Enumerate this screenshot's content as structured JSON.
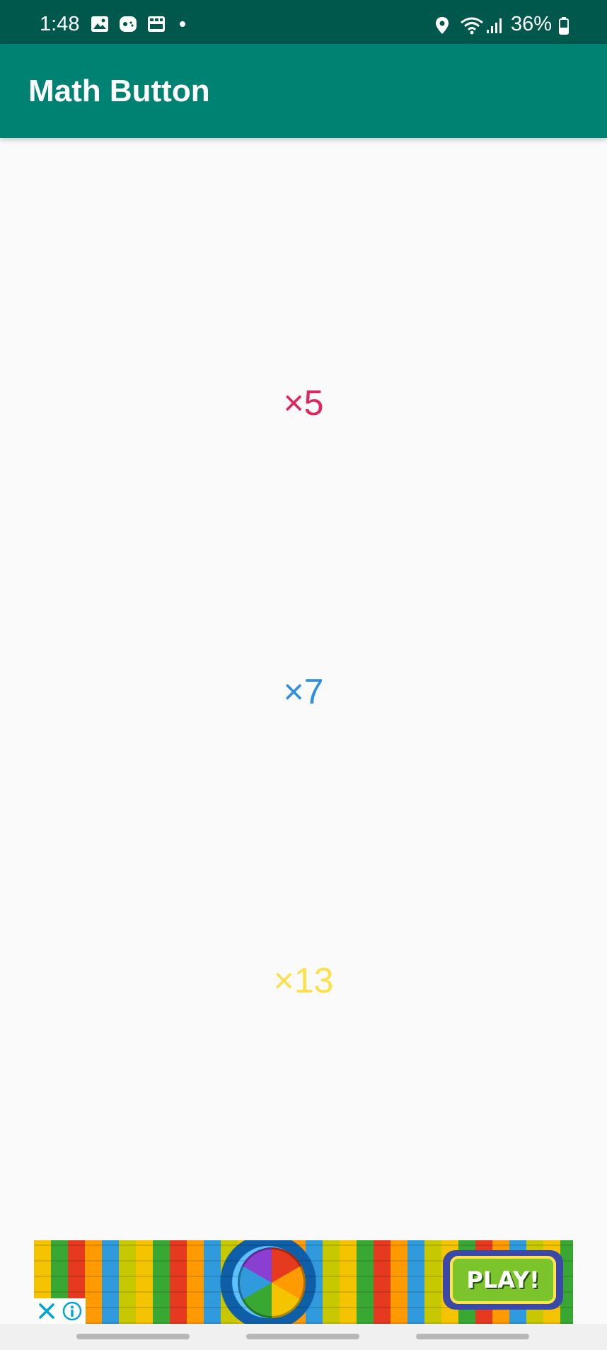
{
  "status_bar": {
    "time": "1:48",
    "battery": "36%",
    "left_icons": [
      "gallery-icon",
      "game-controller-icon",
      "calendar-app-icon",
      "notification-dot-icon"
    ],
    "right_icons": [
      "location-icon",
      "wifi-icon",
      "signal-icon",
      "battery-icon"
    ]
  },
  "app_bar": {
    "title": "Math Button",
    "color": "#008272"
  },
  "buttons": [
    {
      "label": "×5",
      "color": "#e0245e"
    },
    {
      "label": "×7",
      "color": "#2f8fe0"
    },
    {
      "label": "×13",
      "color": "#fde047"
    }
  ],
  "ad": {
    "cta": "PLAY!",
    "icons": [
      "close-icon",
      "info-icon"
    ]
  }
}
